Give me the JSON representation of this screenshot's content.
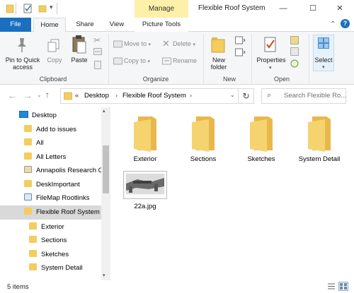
{
  "window": {
    "title": "Flexible Roof System",
    "contextual_tab_group": "Manage",
    "minimize": "—",
    "maximize": "☐",
    "close": "✕"
  },
  "tabs": {
    "file": "File",
    "home": "Home",
    "share": "Share",
    "view": "View",
    "picture_tools": "Picture Tools"
  },
  "ribbon": {
    "clipboard": {
      "group_label": "Clipboard",
      "pin_label_1": "Pin to Quick",
      "pin_label_2": "access",
      "copy": "Copy",
      "paste": "Paste"
    },
    "organize": {
      "group_label": "Organize",
      "move_to": "Move to",
      "copy_to": "Copy to",
      "delete": "Delete",
      "rename": "Rename"
    },
    "new": {
      "group_label": "New",
      "new_folder_1": "New",
      "new_folder_2": "folder"
    },
    "open": {
      "group_label": "Open",
      "properties": "Properties"
    },
    "select": {
      "label": "Select"
    }
  },
  "address": {
    "path": [
      "Desktop",
      "Flexible Roof System"
    ],
    "overflow": "«",
    "search_placeholder": "Search Flexible Ro..."
  },
  "nav_pane": {
    "items": [
      {
        "label": "Desktop",
        "icon": "desktop-icon"
      },
      {
        "label": "Add to issues",
        "icon": "folder-icon"
      },
      {
        "label": "All",
        "icon": "folder-icon"
      },
      {
        "label": "All Letters",
        "icon": "folder-icon"
      },
      {
        "label": "Annapolis Research C",
        "icon": "folder-icon"
      },
      {
        "label": "DeskImportant",
        "icon": "folder-icon"
      },
      {
        "label": "FileMap Rootlinks",
        "icon": "shortcut-icon"
      },
      {
        "label": "Flexible Roof System",
        "icon": "folder-icon"
      },
      {
        "label": "Exterior",
        "icon": "folder-icon"
      },
      {
        "label": "Sections",
        "icon": "folder-icon"
      },
      {
        "label": "Sketches",
        "icon": "folder-icon"
      },
      {
        "label": "System Detail",
        "icon": "folder-icon"
      }
    ],
    "selected_index": 7
  },
  "content": {
    "items": [
      {
        "label": "Exterior",
        "type": "folder"
      },
      {
        "label": "Sections",
        "type": "folder"
      },
      {
        "label": "Sketches",
        "type": "folder"
      },
      {
        "label": "System Detail",
        "type": "folder"
      },
      {
        "label": "22a.jpg",
        "type": "image"
      }
    ]
  },
  "status": {
    "count": "5 items"
  },
  "colors": {
    "accent": "#1a6fbf",
    "manage_tab": "#fdf0a8",
    "folder": "#f3cd5d",
    "selection": "#d9d9d9"
  }
}
